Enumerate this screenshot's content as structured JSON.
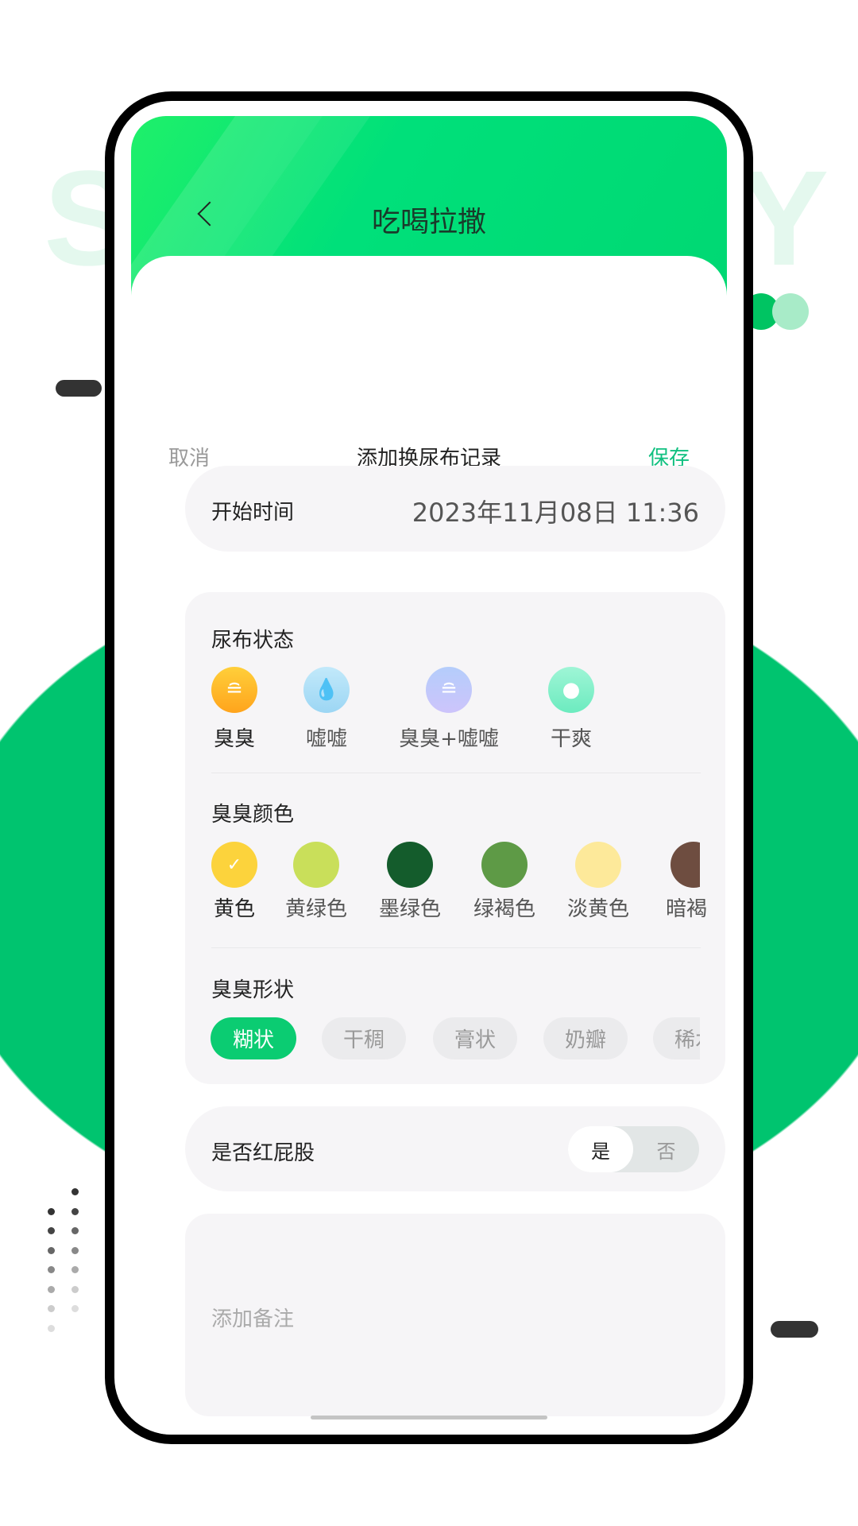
{
  "background": {
    "watermark_left": "S",
    "watermark_right": "Y",
    "accent": "#00c865"
  },
  "header": {
    "title": "吃喝拉撒",
    "back_icon": "chevron-left-icon"
  },
  "action_bar": {
    "cancel": "取消",
    "title": "添加换尿布记录",
    "save": "保存",
    "save_color": "#10c080"
  },
  "start_time": {
    "label": "开始时间",
    "value": "2023年11月08日 11:36"
  },
  "diaper_status": {
    "label": "尿布状态",
    "selected": "臭臭",
    "options": [
      {
        "label": "臭臭",
        "icon": "poop-icon",
        "color": "#ffb52a"
      },
      {
        "label": "嘘嘘",
        "icon": "drops-icon",
        "color": "#a8dcf6"
      },
      {
        "label": "臭臭+嘘嘘",
        "icon": "poop-drops-icon",
        "color": "#bfc6fb"
      },
      {
        "label": "干爽",
        "icon": "drop-icon",
        "color": "#7ff0c6"
      }
    ]
  },
  "poop_color": {
    "label": "臭臭颜色",
    "selected": "黄色",
    "options": [
      {
        "label": "黄色",
        "color": "#fcd33c"
      },
      {
        "label": "黄绿色",
        "color": "#c9df5a"
      },
      {
        "label": "墨绿色",
        "color": "#145c2c"
      },
      {
        "label": "绿褐色",
        "color": "#5e9a46"
      },
      {
        "label": "淡黄色",
        "color": "#fde99a"
      },
      {
        "label": "暗褐",
        "color": "#6e4d40"
      }
    ]
  },
  "poop_shape": {
    "label": "臭臭形状",
    "selected": "糊状",
    "options": [
      "糊状",
      "干稠",
      "膏状",
      "奶瓣",
      "稀水"
    ]
  },
  "red_butt": {
    "label": "是否红屁股",
    "yes": "是",
    "no": "否",
    "selected": "是"
  },
  "notes": {
    "placeholder": "添加备注"
  }
}
